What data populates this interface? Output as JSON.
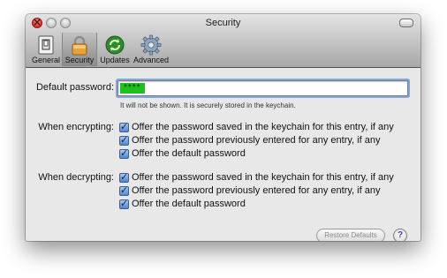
{
  "window": {
    "title": "Security"
  },
  "toolbar": {
    "items": [
      {
        "label": "General",
        "icon": "switch-icon"
      },
      {
        "label": "Security",
        "icon": "lock-icon",
        "selected": true
      },
      {
        "label": "Updates",
        "icon": "refresh-icon"
      },
      {
        "label": "Advanced",
        "icon": "gear-icon"
      }
    ]
  },
  "password": {
    "label": "Default password:",
    "masked_value": "****",
    "hint": "It will not be shown.  It is securely stored in the keychain."
  },
  "encrypting": {
    "label": "When encrypting:",
    "options": [
      {
        "text": "Offer the password saved in the keychain for this entry, if any",
        "checked": true
      },
      {
        "text": "Offer the password previously entered for any entry, if any",
        "checked": true
      },
      {
        "text": "Offer the default password",
        "checked": true
      }
    ]
  },
  "decrypting": {
    "label": "When decrypting:",
    "options": [
      {
        "text": "Offer the password saved in the keychain for this entry, if any",
        "checked": true
      },
      {
        "text": "Offer the password previously entered for any entry, if any",
        "checked": true
      },
      {
        "text": "Offer the default password",
        "checked": true
      }
    ]
  },
  "buttons": {
    "restore_defaults": "Restore Defaults",
    "help": "?"
  },
  "colors": {
    "accent": "#4c86d6",
    "password_fill": "#1ec11e"
  }
}
